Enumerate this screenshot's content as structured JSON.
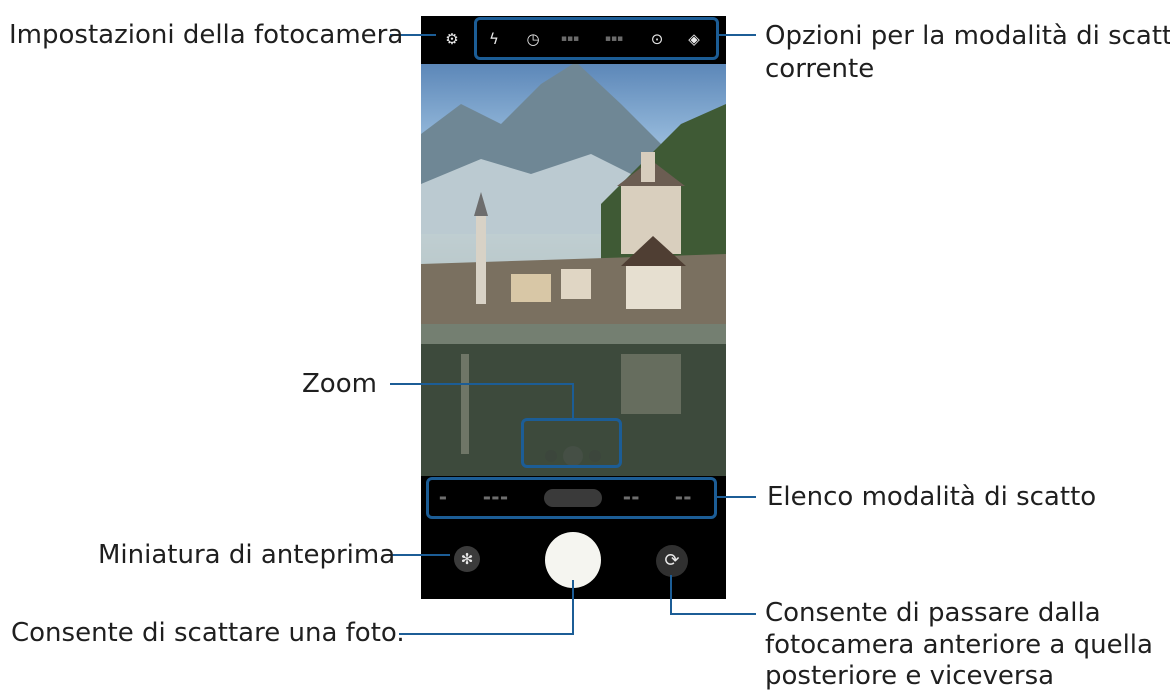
{
  "callouts": {
    "settings": "Impostazioni della fotocamera",
    "options_line1": "Opzioni per la modalità di scatto",
    "options_line2": "corrente",
    "zoom": "Zoom",
    "mode_list": "Elenco modalità di scatto",
    "preview_thumbnail": "Miniatura di anteprima",
    "take_photo": "Consente di scattare una foto.",
    "switch_line1": "Consente di passare dalla",
    "switch_line2": "fotocamera anteriore a quella",
    "switch_line3": "posteriore e viceversa"
  },
  "top_bar_icons": [
    "gear-icon",
    "flash-icon",
    "timer-icon",
    "ratio-icon",
    "resolution-icon",
    "motion-photo-icon",
    "filters-icon"
  ],
  "colors": {
    "accent": "#1c5d96",
    "camera_ui": "#000000",
    "shutter": "#f5f5f0"
  }
}
